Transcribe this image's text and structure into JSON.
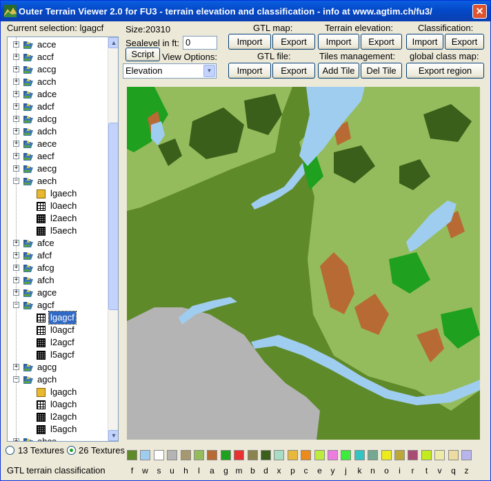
{
  "window": {
    "title": "Outer Terrain Viewer 2.0 for FU3  -  terrain elevation and classification  -  info at www.agtim.ch/fu3/",
    "close_label": "✕"
  },
  "selection": {
    "label": "Current selection: lgagcf"
  },
  "size": {
    "label": "Size:20310"
  },
  "sealevel": {
    "label": "Sealevel in ft:",
    "value": "0"
  },
  "script_button": "Script",
  "view_options": {
    "label": "View Options:",
    "selected": "Elevation"
  },
  "gtl_map": {
    "label": "GTL map:",
    "import": "Import",
    "export": "Export"
  },
  "terrain_elevation": {
    "label": "Terrain elevation:",
    "import": "Import",
    "export": "Export"
  },
  "classification": {
    "label": "Classification:",
    "import": "Import",
    "export": "Export"
  },
  "gtl_file": {
    "label": "GTL file:",
    "import": "Import",
    "export": "Export"
  },
  "tiles": {
    "label": "Tiles management:",
    "add": "Add Tile",
    "del": "Del Tile"
  },
  "global_class_map": {
    "label": "global class map:",
    "export": "Export region"
  },
  "tree": {
    "items": [
      {
        "label": "acce",
        "type": "folder",
        "expanded": false
      },
      {
        "label": "accf",
        "type": "folder",
        "expanded": false
      },
      {
        "label": "accg",
        "type": "folder",
        "expanded": false
      },
      {
        "label": "acch",
        "type": "folder",
        "expanded": false
      },
      {
        "label": "adce",
        "type": "folder",
        "expanded": false
      },
      {
        "label": "adcf",
        "type": "folder",
        "expanded": false
      },
      {
        "label": "adcg",
        "type": "folder",
        "expanded": false
      },
      {
        "label": "adch",
        "type": "folder",
        "expanded": false
      },
      {
        "label": "aece",
        "type": "folder",
        "expanded": false
      },
      {
        "label": "aecf",
        "type": "folder",
        "expanded": false
      },
      {
        "label": "aecg",
        "type": "folder",
        "expanded": false
      },
      {
        "label": "aech",
        "type": "folder",
        "expanded": true
      },
      {
        "label": "lgaech",
        "type": "gold"
      },
      {
        "label": "l0aech",
        "type": "grid"
      },
      {
        "label": "l2aech",
        "type": "grid2"
      },
      {
        "label": "l5aech",
        "type": "grid2"
      },
      {
        "label": "afce",
        "type": "folder",
        "expanded": false
      },
      {
        "label": "afcf",
        "type": "folder",
        "expanded": false
      },
      {
        "label": "afcg",
        "type": "folder",
        "expanded": false
      },
      {
        "label": "afch",
        "type": "folder",
        "expanded": false
      },
      {
        "label": "agce",
        "type": "folder",
        "expanded": false
      },
      {
        "label": "agcf",
        "type": "folder",
        "expanded": true
      },
      {
        "label": "lgagcf",
        "type": "grid",
        "selected": true
      },
      {
        "label": "l0agcf",
        "type": "grid"
      },
      {
        "label": "l2agcf",
        "type": "grid2"
      },
      {
        "label": "l5agcf",
        "type": "grid2"
      },
      {
        "label": "agcg",
        "type": "folder",
        "expanded": false
      },
      {
        "label": "agch",
        "type": "folder",
        "expanded": true
      },
      {
        "label": "lgagch",
        "type": "gold"
      },
      {
        "label": "l0agch",
        "type": "grid"
      },
      {
        "label": "l2agch",
        "type": "grid2"
      },
      {
        "label": "l5agch",
        "type": "grid2"
      },
      {
        "label": "ahce",
        "type": "folder",
        "expanded": false
      }
    ]
  },
  "textures": {
    "option13": "13 Textures",
    "option26": "26 Textures",
    "selected": "26 Textures"
  },
  "status": "GTL terrain classification",
  "legend": [
    {
      "label": "f",
      "color": "#5f8a2a"
    },
    {
      "label": "w",
      "color": "#9fcdf0"
    },
    {
      "label": "s",
      "color": "#ffffff"
    },
    {
      "label": "u",
      "color": "#b4b4b4"
    },
    {
      "label": "h",
      "color": "#a89870"
    },
    {
      "label": "l",
      "color": "#94bc5c"
    },
    {
      "label": "a",
      "color": "#b86a34"
    },
    {
      "label": "g",
      "color": "#1fa01f"
    },
    {
      "label": "m",
      "color": "#e83232"
    },
    {
      "label": "b",
      "color": "#8c8450"
    },
    {
      "label": "d",
      "color": "#3a5f1a"
    },
    {
      "label": "x",
      "color": "#a8dcc4"
    },
    {
      "label": "p",
      "color": "#e8b83c"
    },
    {
      "label": "c",
      "color": "#ec8a1c"
    },
    {
      "label": "e",
      "color": "#bcec3c"
    },
    {
      "label": "y",
      "color": "#ec7ce0"
    },
    {
      "label": "j",
      "color": "#3cec3c"
    },
    {
      "label": "k",
      "color": "#34c4c4"
    },
    {
      "label": "n",
      "color": "#74a890"
    },
    {
      "label": "o",
      "color": "#ecec1c"
    },
    {
      "label": "i",
      "color": "#bca838"
    },
    {
      "label": "r",
      "color": "#a84c74"
    },
    {
      "label": "t",
      "color": "#c4ec1c"
    },
    {
      "label": "v",
      "color": "#ececa8"
    },
    {
      "label": "q",
      "color": "#ecdca0"
    },
    {
      "label": "z",
      "color": "#b8b4ec"
    }
  ]
}
